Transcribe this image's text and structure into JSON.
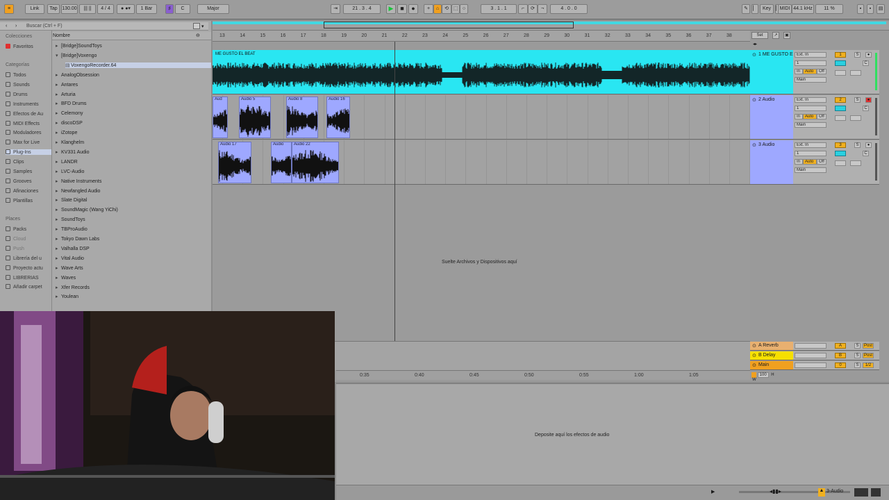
{
  "transport": {
    "link": "Link",
    "tap": "Tap",
    "tempo": "130.00",
    "time_sig": "4 / 4",
    "quantize": "1 Bar",
    "key": "C",
    "scale": "Major",
    "position": "21 . 3 . 4",
    "loop_start": "3 . 1 . 1",
    "loop_length": "4 . 0 . 0",
    "key_label": "Key",
    "midi_label": "MIDI",
    "sample_rate": "44.1 kHz",
    "cpu": "11 %"
  },
  "browser": {
    "search_placeholder": "Buscar (Ctrl + F)",
    "collections_header": "Colecciones",
    "favorites": "Favoritos",
    "categories_header": "Categorías",
    "categories": [
      "Todos",
      "Sounds",
      "Drums",
      "Instruments",
      "Efectos de Au",
      "MIDI Effects",
      "Moduladores",
      "Max for Live",
      "Plug-Ins",
      "Clips",
      "Samples",
      "Grooves",
      "Afinaciones",
      "Plantillas"
    ],
    "places_header": "Places",
    "places": [
      "Packs",
      "Cloud",
      "Push",
      "Librería del u",
      "Proyecto actu",
      "LIBRERIAS",
      "Añadir carpet"
    ],
    "name_header": "Nombre",
    "items": [
      "[Bridge]SoundToys",
      "[Bridge]Voxengo",
      "VoxengoRecorder.64",
      "AnalogObsession",
      "Antares",
      "Arturia",
      "BFD Drums",
      "Celemony",
      "discoDSP",
      "iZotope",
      "Klanghelm",
      "KV331 Audio",
      "LANDR",
      "LVC-Audio",
      "Native Instruments",
      "Newfangled Audio",
      "Slate Digital",
      "SoundMagic (Wang YiChi)",
      "SoundToys",
      "TBProAudio",
      "Tokyo Dawn Labs",
      "Valhalla DSP",
      "Vital Audio",
      "Wave Arts",
      "Waves",
      "Xfer Records",
      "Youlean"
    ]
  },
  "ruler": {
    "bars": [
      "13",
      "14",
      "15",
      "16",
      "17",
      "18",
      "19",
      "20",
      "21",
      "22",
      "23",
      "24",
      "25",
      "26",
      "27",
      "28",
      "29",
      "30",
      "31",
      "32",
      "33",
      "34",
      "35",
      "36",
      "37",
      "38"
    ],
    "times": [
      "0:35",
      "0:40",
      "0:45",
      "0:50",
      "0:55",
      "1:00",
      "1:05"
    ],
    "set_label": "Set"
  },
  "tracks": [
    {
      "name": "1 ME GUSTO E",
      "clip_title": "ME GUSTO EL BEAT",
      "input": "Ext. In",
      "channel": "1",
      "out": "Main",
      "number": "1",
      "color": "#29e6f2"
    },
    {
      "name": "2 Audio",
      "input": "Ext. In",
      "channel": "1",
      "out": "Main",
      "number": "2",
      "color": "#9ea8ff",
      "clips": [
        "Aud",
        "Audio 5",
        "Audio 8",
        "Audio 16"
      ]
    },
    {
      "name": "3 Audio",
      "input": "Ext. In",
      "channel": "1",
      "out": "Main",
      "number": "3",
      "color": "#9ea8ff",
      "clips": [
        "Audio 17",
        "Audio",
        "Audio 22"
      ]
    }
  ],
  "returns": [
    {
      "name": "A Reverb",
      "letter": "A",
      "post": "Post",
      "color": "#e8b070"
    },
    {
      "name": "B Delay",
      "letter": "B",
      "post": "Post",
      "color": "#f6e000"
    },
    {
      "name": "Main",
      "letter": "0",
      "post": "1/2",
      "color": "#f0a020"
    }
  ],
  "mixer_labels": {
    "in": "In",
    "auto": "Auto",
    "off": "Off",
    "solo": "S",
    "cue": "C"
  },
  "drop_hint": "Suelte Archivos y Dispositivos aquí",
  "device_hint": "Deposite aquí los efectos de audio",
  "zoom_label": "100",
  "selected_track": "3-Audio"
}
